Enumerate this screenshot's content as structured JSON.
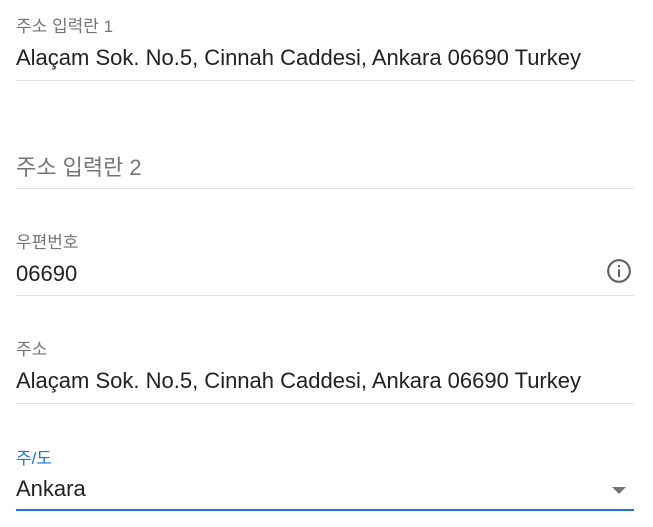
{
  "form": {
    "address_line1": {
      "label": "주소 입력란 1",
      "value": "Alaçam Sok. No.5, Cinnah Caddesi, Ankara 06690 Turkey"
    },
    "address_line2": {
      "placeholder": "주소 입력란 2",
      "value": ""
    },
    "postal_code": {
      "label": "우편번호",
      "value": "06690",
      "icon": "info-icon"
    },
    "address": {
      "label": "주소",
      "value": "Alaçam Sok. No.5, Cinnah Caddesi, Ankara 06690 Turkey"
    },
    "state": {
      "label": "주/도",
      "value": "Ankara",
      "icon": "chevron-down-icon"
    }
  },
  "colors": {
    "accent": "#1a73e8",
    "label": "#757575",
    "text": "#202124",
    "divider": "#e0e0e0"
  }
}
